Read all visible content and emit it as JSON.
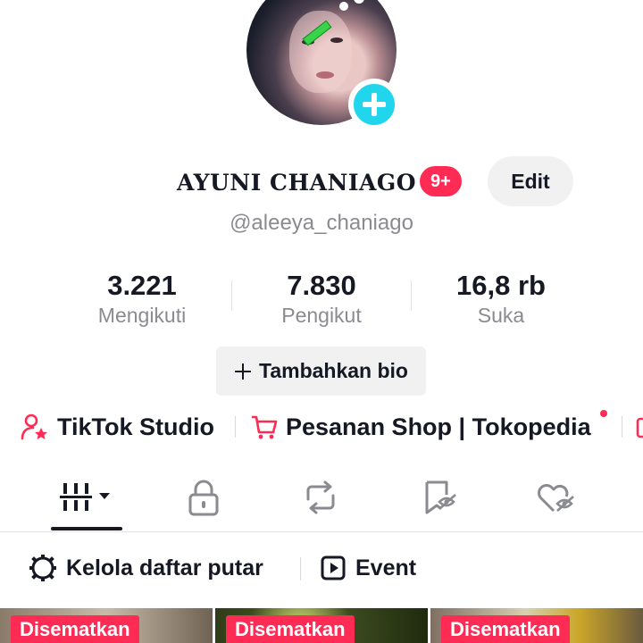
{
  "profile": {
    "display_name": "AYUNI CHANIAGO",
    "notification_badge": "9+",
    "edit_label": "Edit",
    "username": "@aleeya_chaniago"
  },
  "stats": [
    {
      "value": "3.221",
      "label": "Mengikuti"
    },
    {
      "value": "7.830",
      "label": "Pengikut"
    },
    {
      "value": "16,8 rb",
      "label": "Suka"
    }
  ],
  "bio_button": {
    "label": "Tambahkan bio",
    "icon": "plus-icon"
  },
  "links": [
    {
      "label": "TikTok Studio",
      "icon": "person-star-icon"
    },
    {
      "label": "Pesanan Shop | Tokopedia",
      "icon": "cart-icon"
    }
  ],
  "tabs": [
    {
      "name": "videos",
      "icon": "grid-bars-icon",
      "selected": true
    },
    {
      "name": "private",
      "icon": "lock-icon"
    },
    {
      "name": "reposts",
      "icon": "repost-icon"
    },
    {
      "name": "favorites",
      "icon": "bookmark-hidden-icon"
    },
    {
      "name": "liked",
      "icon": "heart-hidden-icon"
    }
  ],
  "subrow": {
    "playlist_label": "Kelola daftar putar",
    "event_label": "Event"
  },
  "videos": [
    {
      "badge": "Disematkan"
    },
    {
      "badge": "Disematkan"
    },
    {
      "badge": "Disematkan"
    }
  ],
  "colors": {
    "accent": "#fe2c55",
    "add_badge": "#20d5ec",
    "text_primary": "#161823",
    "text_secondary": "#8a8b91",
    "chip_bg": "#f1f1f2"
  }
}
